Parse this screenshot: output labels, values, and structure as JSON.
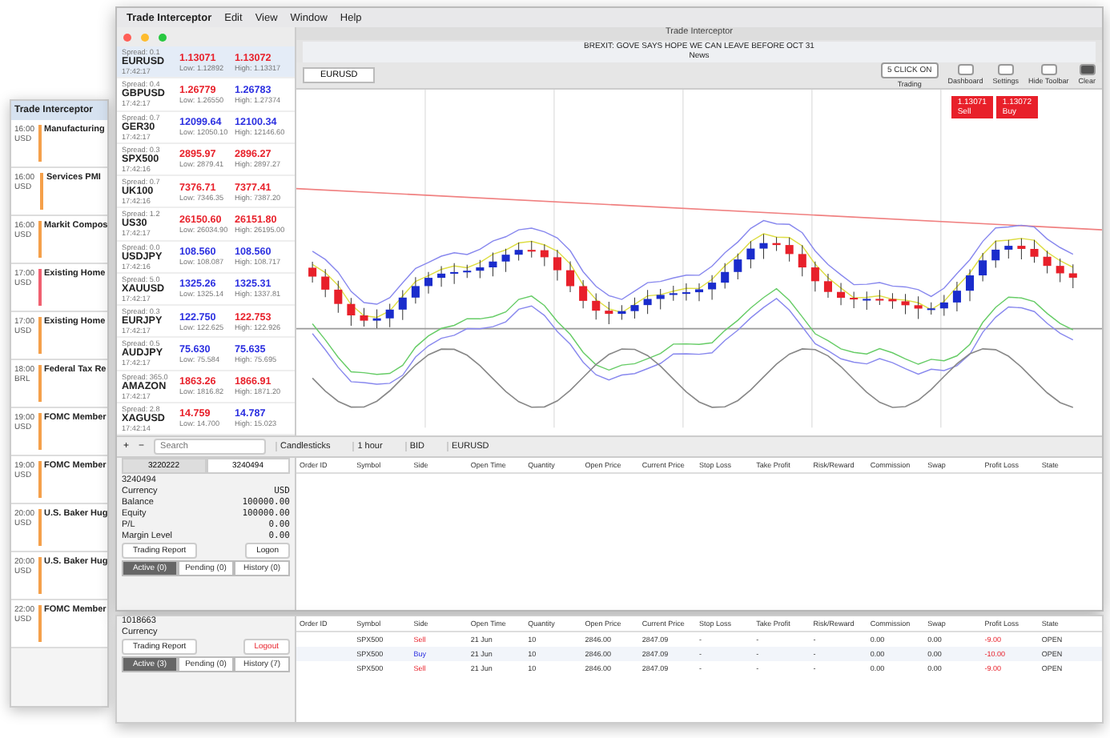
{
  "menu_bar": {
    "app": "Trade Interceptor",
    "items": [
      "Edit",
      "View",
      "Window",
      "Help"
    ]
  },
  "window": {
    "title": "Trade Interceptor"
  },
  "news": {
    "headline": "BREXIT: GOVE SAYS HOPE WE CAN LEAVE BEFORE OCT 31",
    "label": "News"
  },
  "chart_tabs": [
    {
      "label": "EURUSD",
      "selected": true
    }
  ],
  "toolbar_buttons": [
    {
      "kind": "toggle",
      "value": "5 CLICK ON",
      "label": "Trading"
    },
    {
      "kind": "icon",
      "label": "Dashboard"
    },
    {
      "kind": "icon",
      "label": "Settings"
    },
    {
      "kind": "icon",
      "label": "Hide Toolbar"
    },
    {
      "kind": "dark",
      "label": "Clear"
    }
  ],
  "quote": {
    "sell_price": "1.13071",
    "sell_label": "Sell",
    "buy_price": "1.13072",
    "buy_label": "Buy"
  },
  "watchlist": [
    {
      "symbol": "EURUSD",
      "spread": "Spread: 0.1",
      "time": "17:42:17",
      "bid": {
        "price": "1.13071",
        "color": "#e8202a"
      },
      "low": "Low: 1.12892",
      "ask": {
        "price": "1.13072",
        "color": "#e8202a"
      },
      "high": "High: 1.13317",
      "selected": true
    },
    {
      "symbol": "GBPUSD",
      "spread": "Spread: 0.4",
      "time": "17:42:17",
      "bid": {
        "price": "1.26779",
        "color": "#e8202a"
      },
      "low": "Low: 1.26550",
      "ask": {
        "price": "1.26783",
        "color": "#2a2ee0"
      },
      "high": "High: 1.27374",
      "selected": false
    },
    {
      "symbol": "GER30",
      "spread": "Spread: 0.7",
      "time": "17:42:17",
      "bid": {
        "price": "12099.64",
        "color": "#2a2ee0"
      },
      "low": "Low: 12050.10",
      "ask": {
        "price": "12100.34",
        "color": "#2a2ee0"
      },
      "high": "High: 12146.60",
      "selected": false
    },
    {
      "symbol": "SPX500",
      "spread": "Spread: 0.3",
      "time": "17:42:16",
      "bid": {
        "price": "2895.97",
        "color": "#e8202a"
      },
      "low": "Low: 2879.41",
      "ask": {
        "price": "2896.27",
        "color": "#e8202a"
      },
      "high": "High: 2897.27",
      "selected": false
    },
    {
      "symbol": "UK100",
      "spread": "Spread: 0.7",
      "time": "17:42:16",
      "bid": {
        "price": "7376.71",
        "color": "#e8202a"
      },
      "low": "Low: 7346.35",
      "ask": {
        "price": "7377.41",
        "color": "#e8202a"
      },
      "high": "High: 7387.20",
      "selected": false
    },
    {
      "symbol": "US30",
      "spread": "Spread: 1.2",
      "time": "17:42:17",
      "bid": {
        "price": "26150.60",
        "color": "#e8202a"
      },
      "low": "Low: 26034.90",
      "ask": {
        "price": "26151.80",
        "color": "#e8202a"
      },
      "high": "High: 26195.00",
      "selected": false
    },
    {
      "symbol": "USDJPY",
      "spread": "Spread: 0.0",
      "time": "17:42:16",
      "bid": {
        "price": "108.560",
        "color": "#2a2ee0"
      },
      "low": "Low: 108.087",
      "ask": {
        "price": "108.560",
        "color": "#2a2ee0"
      },
      "high": "High: 108.717",
      "selected": false
    },
    {
      "symbol": "XAUUSD",
      "spread": "Spread: 5.0",
      "time": "17:42:17",
      "bid": {
        "price": "1325.26",
        "color": "#2a2ee0"
      },
      "low": "Low: 1325.14",
      "ask": {
        "price": "1325.31",
        "color": "#2a2ee0"
      },
      "high": "High: 1337.81",
      "selected": false
    },
    {
      "symbol": "EURJPY",
      "spread": "Spread: 0.3",
      "time": "17:42:17",
      "bid": {
        "price": "122.750",
        "color": "#2a2ee0"
      },
      "low": "Low: 122.625",
      "ask": {
        "price": "122.753",
        "color": "#e8202a"
      },
      "high": "High: 122.926",
      "selected": false
    },
    {
      "symbol": "AUDJPY",
      "spread": "Spread: 0.5",
      "time": "17:42:17",
      "bid": {
        "price": "75.630",
        "color": "#2a2ee0"
      },
      "low": "Low: 75.584",
      "ask": {
        "price": "75.635",
        "color": "#2a2ee0"
      },
      "high": "High: 75.695",
      "selected": false
    },
    {
      "symbol": "AMAZON",
      "spread": "Spread: 365.0",
      "time": "17:42:17",
      "bid": {
        "price": "1863.26",
        "color": "#e8202a"
      },
      "low": "Low: 1816.82",
      "ask": {
        "price": "1866.91",
        "color": "#e8202a"
      },
      "high": "High: 1871.20",
      "selected": false
    },
    {
      "symbol": "XAGUSD",
      "spread": "Spread: 2.8",
      "time": "17:42:14",
      "bid": {
        "price": "14.759",
        "color": "#e8202a"
      },
      "low": "Low: 14.700",
      "ask": {
        "price": "14.787",
        "color": "#2a2ee0"
      },
      "high": "High: 15.023",
      "selected": false
    }
  ],
  "chart_toolbar": {
    "buttons": [
      "+",
      "−"
    ],
    "search_placeholder": "Search",
    "chart_type": "Candlesticks",
    "timeframe": "1 hour",
    "price": "BID",
    "symbol": "EURUSD"
  },
  "account": {
    "tabs": [
      {
        "label": "3220222",
        "selected": false
      },
      {
        "label": "3240494",
        "selected": true
      }
    ],
    "number": "3240494",
    "fields": [
      {
        "label": "Currency",
        "value": "USD"
      },
      {
        "label": "Balance",
        "value": "100000.00"
      },
      {
        "label": "Equity",
        "value": "100000.00"
      },
      {
        "label": "P/L",
        "value": "0.00"
      }
    ],
    "margin": {
      "label": "Margin Level",
      "value": "0.00"
    },
    "buttons": [
      "Trading Report",
      "Logon"
    ],
    "order_tabs": [
      {
        "label": "Active (0)",
        "selected": true
      },
      {
        "label": "Pending (0)",
        "selected": false
      },
      {
        "label": "History (0)",
        "selected": false
      }
    ]
  },
  "orders": {
    "columns": [
      "Order ID",
      "Symbol",
      "Side",
      "Open Time",
      "Quantity",
      "Open Price",
      "Current Price",
      "Stop Loss",
      "Take Profit",
      "Risk/Reward",
      "Commission",
      "Swap",
      "Profit Loss",
      "State"
    ]
  },
  "back_window": {
    "title": "Trade Interceptor",
    "events": [
      {
        "time": "16:00",
        "currency": "USD",
        "title": "Manufacturing",
        "color": "#f5a04a"
      },
      {
        "time": "16:00",
        "currency": "USD",
        "title": "Services PMI",
        "color": "#f5a04a"
      },
      {
        "time": "16:00",
        "currency": "USD",
        "title": "Markit Compos",
        "color": "#f5a04a"
      },
      {
        "time": "17:00",
        "currency": "USD",
        "title": "Existing Home",
        "color": "#f06070"
      },
      {
        "time": "17:00",
        "currency": "USD",
        "title": "Existing Home",
        "color": "#f5a04a"
      },
      {
        "time": "18:00",
        "currency": "BRL",
        "title": "Federal Tax Re",
        "color": "#f5a04a"
      },
      {
        "time": "19:00",
        "currency": "USD",
        "title": "FOMC Member",
        "color": "#f5a04a"
      },
      {
        "time": "19:00",
        "currency": "USD",
        "title": "FOMC Member",
        "color": "#f5a04a"
      },
      {
        "time": "20:00",
        "currency": "USD",
        "title": "U.S. Baker Hug",
        "color": "#f5a04a"
      },
      {
        "time": "20:00",
        "currency": "USD",
        "title": "U.S. Baker Hug",
        "color": "#f5a04a"
      },
      {
        "time": "22:00",
        "currency": "USD",
        "title": "FOMC Member",
        "color": "#f5a04a"
      }
    ]
  },
  "bottom_window": {
    "account": "1018663",
    "currency_label": "Currency",
    "buttons": [
      {
        "label": "Trading Report",
        "kind": "plain"
      },
      {
        "label": "Logout",
        "kind": "danger"
      }
    ],
    "tabs": [
      {
        "label": "Active (3)",
        "selected": true
      },
      {
        "label": "Pending (0)",
        "selected": false
      },
      {
        "label": "History (7)",
        "selected": false
      }
    ],
    "columns": [
      "Order ID",
      "Symbol",
      "Side",
      "Open Time",
      "Quantity",
      "Open Price",
      "Current Price",
      "Stop Loss",
      "Take Profit",
      "Risk/Reward",
      "Commission",
      "Swap",
      "Profit Loss",
      "State"
    ],
    "rows": [
      {
        "symbol": "SPX500",
        "side": "Sell",
        "kind": "sell",
        "open_time": "21 Jun",
        "quantity": "10",
        "open_price": "2846.00",
        "current_price": "2847.09",
        "stop_loss": "-",
        "take_profit": "-",
        "risk_reward": "-",
        "commission": "0.00",
        "swap": "0.00",
        "profit_loss": "-9.00",
        "state": "OPEN"
      },
      {
        "symbol": "SPX500",
        "side": "Buy",
        "kind": "buy",
        "open_time": "21 Jun",
        "quantity": "10",
        "open_price": "2846.00",
        "current_price": "2847.09",
        "stop_loss": "-",
        "take_profit": "-",
        "risk_reward": "-",
        "commission": "0.00",
        "swap": "0.00",
        "profit_loss": "-10.00",
        "state": "OPEN"
      },
      {
        "symbol": "SPX500",
        "side": "Sell",
        "kind": "sell",
        "open_time": "21 Jun",
        "quantity": "10",
        "open_price": "2846.00",
        "current_price": "2847.09",
        "stop_loss": "-",
        "take_profit": "-",
        "risk_reward": "-",
        "commission": "0.00",
        "swap": "0.00",
        "profit_loss": "-9.00",
        "state": "OPEN"
      }
    ]
  }
}
